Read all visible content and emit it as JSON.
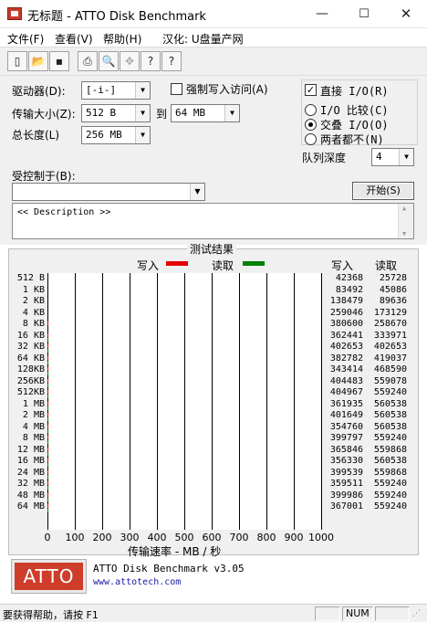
{
  "window": {
    "title": "无标题 - ATTO Disk Benchmark",
    "minimize": "—",
    "maximize": "☐",
    "close": "✕"
  },
  "menu": {
    "file": "文件(F)",
    "view": "查看(V)",
    "help": "帮助(H)",
    "localize": "汉化: U盘量产网"
  },
  "toolbar": {
    "new": "▯",
    "open": "📂",
    "save": "▪",
    "print": "⎙",
    "preview": "🔍",
    "move": "✥",
    "help": "?"
  },
  "settings": {
    "drive_label": "驱动器(D):",
    "drive_value": "[-i-]",
    "write_through_label": "强制写入访问(A)",
    "transfer_label": "传输大小(Z):",
    "transfer_from": "512 B",
    "transfer_to_label": "到",
    "transfer_to": "64 MB",
    "length_label": "总长度(L)",
    "length_value": "256 MB",
    "direct_io_label": "直接 I/O(R)",
    "io_compare_label": "I/O 比较(C)",
    "overlapped_label": "交叠 I/O(O)",
    "neither_label": "两者都不(N)",
    "queue_label": "队列深度",
    "queue_value": "4",
    "controlled_by_label": "受控制于(B):",
    "controlled_by_value": "",
    "start_button": "开始(S)",
    "description": "<< Description >>"
  },
  "results": {
    "title": "测试结果",
    "write_label": "写入",
    "read_label": "读取",
    "write_col": "写入",
    "read_col": "读取",
    "xaxis_label": "传输速率 - MB / 秒",
    "write_color": "#e60000",
    "read_color": "#008000"
  },
  "chart_data": {
    "type": "bar",
    "orientation": "horizontal",
    "title": "测试结果",
    "xlabel": "传输速率 - MB / 秒",
    "xlim": [
      0,
      1000
    ],
    "xticks": [
      "0",
      "100",
      "200",
      "300",
      "400",
      "500",
      "600",
      "700",
      "800",
      "900",
      "1000"
    ],
    "categories": [
      "512 B",
      "1 KB",
      "2 KB",
      "4 KB",
      "8 KB",
      "16 KB",
      "32 KB",
      "64 KB",
      "128KB",
      "256KB",
      "512KB",
      "1 MB",
      "2 MB",
      "4 MB",
      "8 MB",
      "12 MB",
      "16 MB",
      "24 MB",
      "32 MB",
      "48 MB",
      "64 MB"
    ],
    "series": [
      {
        "name": "写入",
        "color": "#e60000",
        "values": [
          42368,
          83492,
          138479,
          259046,
          380600,
          362441,
          402653,
          382782,
          343414,
          404483,
          404967,
          361935,
          401649,
          354760,
          399797,
          365846,
          356330,
          399539,
          359511,
          399986,
          367001
        ]
      },
      {
        "name": "读取",
        "color": "#008000",
        "values": [
          25728,
          45086,
          89636,
          173129,
          258670,
          333971,
          402653,
          419037,
          468590,
          559078,
          559240,
          560538,
          560538,
          560538,
          559240,
          559868,
          560538,
          559868,
          559240,
          559240,
          559240
        ]
      }
    ]
  },
  "footer": {
    "logo_text": "ATTO",
    "product": "ATTO Disk Benchmark v3.05",
    "url": "www.attotech.com"
  },
  "status": {
    "hint": "要获得帮助，请按 F1",
    "num": "NUM"
  }
}
